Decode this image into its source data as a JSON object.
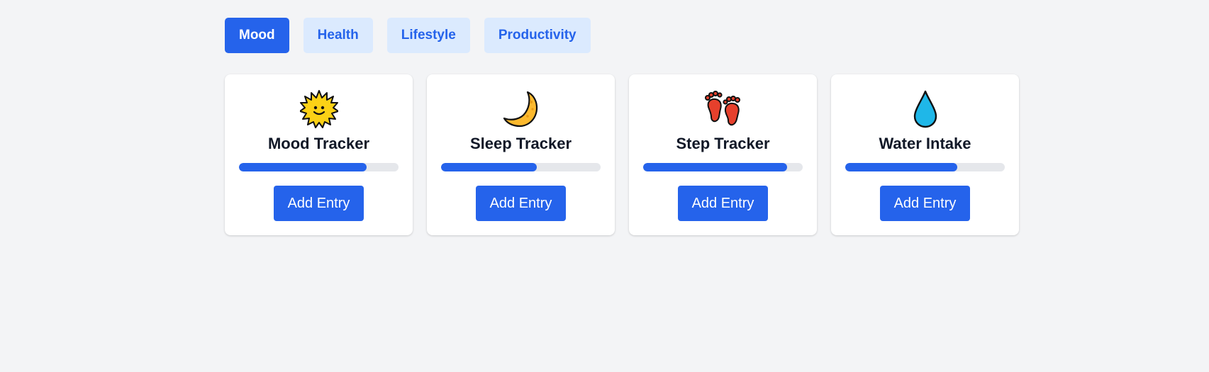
{
  "tabs": [
    {
      "label": "Mood",
      "active": true
    },
    {
      "label": "Health",
      "active": false
    },
    {
      "label": "Lifestyle",
      "active": false
    },
    {
      "label": "Productivity",
      "active": false
    }
  ],
  "cards": [
    {
      "title": "Mood Tracker",
      "icon": "sun-face-icon",
      "progress": 0.8,
      "button_label": "Add Entry"
    },
    {
      "title": "Sleep Tracker",
      "icon": "crescent-moon-icon",
      "progress": 0.6,
      "button_label": "Add Entry"
    },
    {
      "title": "Step Tracker",
      "icon": "footprints-icon",
      "progress": 0.9,
      "button_label": "Add Entry"
    },
    {
      "title": "Water Intake",
      "icon": "droplet-icon",
      "progress": 0.7,
      "button_label": "Add Entry"
    }
  ],
  "colors": {
    "accent": "#2563eb",
    "tab_inactive_bg": "#dbeafe",
    "track": "#e5e7eb",
    "background": "#f3f4f6"
  }
}
